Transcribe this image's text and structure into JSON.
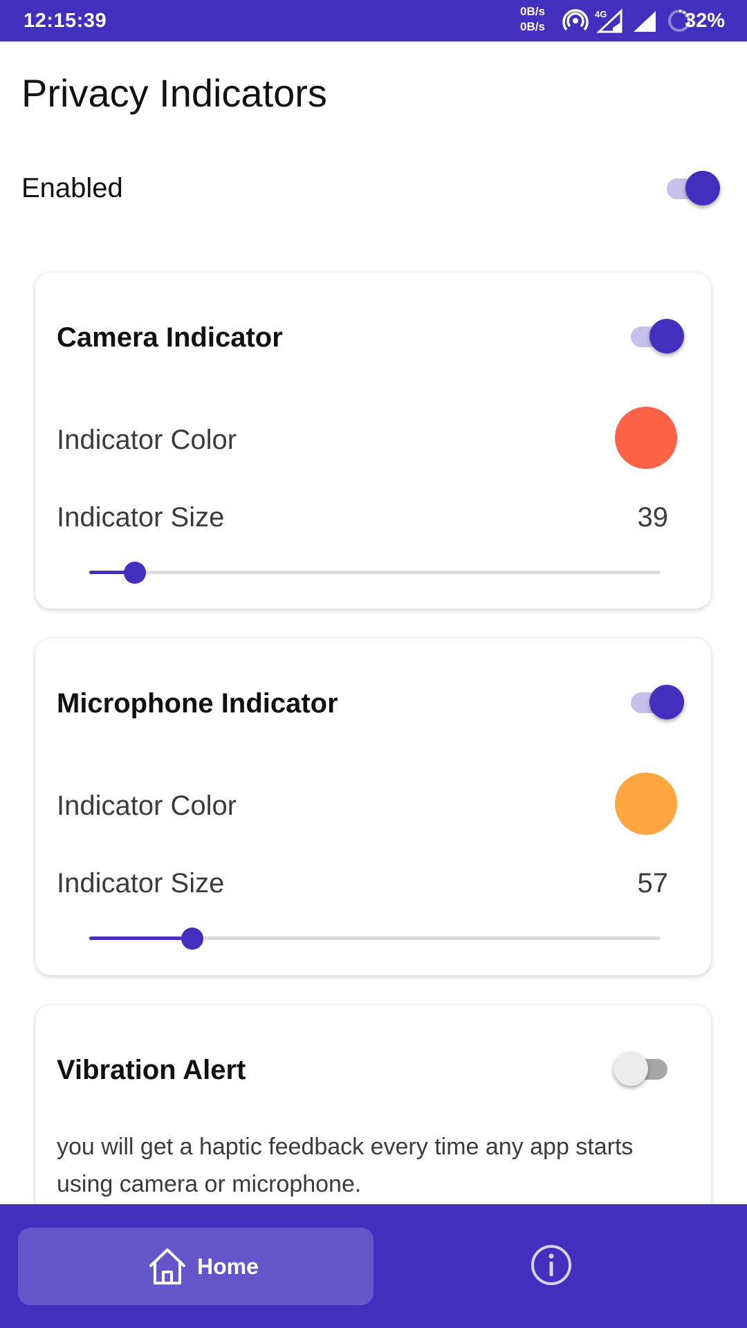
{
  "status_bar": {
    "time": "12:15:39",
    "net_up": "0B/s",
    "net_down": "0B/s",
    "network_type": "4G",
    "battery": "32%",
    "icons": [
      "hotspot-icon",
      "signal-4g-icon",
      "signal-icon",
      "battery-icon"
    ]
  },
  "page": {
    "title": "Privacy Indicators",
    "enabled_label": "Enabled",
    "enabled": true
  },
  "cards": {
    "camera": {
      "title": "Camera Indicator",
      "enabled": true,
      "color_label": "Indicator Color",
      "color": "#ff6347",
      "size_label": "Indicator Size",
      "size_value": "39",
      "slider_fraction": 0.08
    },
    "microphone": {
      "title": "Microphone Indicator",
      "enabled": true,
      "color_label": "Indicator Color",
      "color": "#ffa640",
      "size_label": "Indicator Size",
      "size_value": "57",
      "slider_fraction": 0.18
    },
    "vibration": {
      "title": "Vibration Alert",
      "enabled": false,
      "description": "you will get a haptic feedback every time any app starts using camera or microphone."
    }
  },
  "nav": {
    "home_label": "Home",
    "home_icon": "home-icon",
    "info_icon": "info-icon"
  },
  "colors": {
    "accent": "#432fbd",
    "accent_light": "#c6c0ec",
    "nav_selected": "#6456ca"
  }
}
